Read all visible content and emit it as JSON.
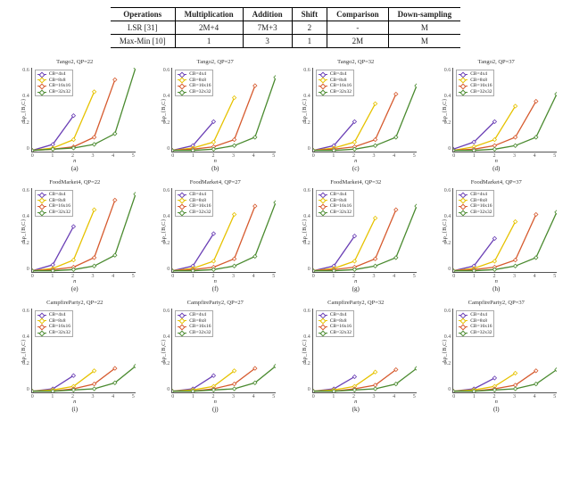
{
  "table": {
    "headers": [
      "Operations",
      "Multiplication",
      "Addition",
      "Shift",
      "Comparison",
      "Down-sampling"
    ],
    "rows": [
      {
        "name": "LSR [31]",
        "cells": [
          "2M+4",
          "7M+3",
          "2",
          "-",
          "M"
        ]
      },
      {
        "name": "Max-Min [10]",
        "cells": [
          "1",
          "3",
          "1",
          "2M",
          "M"
        ]
      }
    ]
  },
  "chart_common": {
    "ylabel": "Δρ_{B,C}",
    "xlabel": "n",
    "xticks": [
      "0",
      "1",
      "2",
      "3",
      "4",
      "5"
    ],
    "yticks": [
      "0",
      "0.2",
      "0.4",
      "0.6"
    ],
    "ylim": [
      0,
      0.7
    ],
    "xlim": [
      0,
      5
    ],
    "legend": [
      {
        "label": "CB=4x4",
        "color": "#6a3fb5"
      },
      {
        "label": "CB=8x8",
        "color": "#e6c200"
      },
      {
        "label": "CB=16x16",
        "color": "#d65a2e"
      },
      {
        "label": "CB=32x32",
        "color": "#4a8a2f"
      }
    ]
  },
  "chart_data": [
    {
      "id": "a",
      "title": "Tango2, QP=22",
      "series": [
        {
          "name": "CB=4x4",
          "color": "#6a3fb5",
          "x": [
            0,
            1,
            2
          ],
          "y": [
            0.01,
            0.06,
            0.3
          ]
        },
        {
          "name": "CB=8x8",
          "color": "#e6c200",
          "x": [
            0,
            1,
            2,
            3
          ],
          "y": [
            0.01,
            0.03,
            0.1,
            0.5
          ]
        },
        {
          "name": "CB=16x16",
          "color": "#d65a2e",
          "x": [
            0,
            1,
            2,
            3,
            4
          ],
          "y": [
            0.01,
            0.02,
            0.04,
            0.12,
            0.6
          ]
        },
        {
          "name": "CB=32x32",
          "color": "#4a8a2f",
          "x": [
            0,
            1,
            2,
            3,
            4,
            5
          ],
          "y": [
            0.01,
            0.02,
            0.03,
            0.06,
            0.15,
            0.7
          ]
        }
      ]
    },
    {
      "id": "b",
      "title": "Tango2, QP=27",
      "series": [
        {
          "name": "CB=4x4",
          "color": "#6a3fb5",
          "x": [
            0,
            1,
            2
          ],
          "y": [
            0.01,
            0.05,
            0.25
          ]
        },
        {
          "name": "CB=8x8",
          "color": "#e6c200",
          "x": [
            0,
            1,
            2,
            3
          ],
          "y": [
            0.01,
            0.03,
            0.08,
            0.45
          ]
        },
        {
          "name": "CB=16x16",
          "color": "#d65a2e",
          "x": [
            0,
            1,
            2,
            3,
            4
          ],
          "y": [
            0.01,
            0.02,
            0.04,
            0.1,
            0.55
          ]
        },
        {
          "name": "CB=32x32",
          "color": "#4a8a2f",
          "x": [
            0,
            1,
            2,
            3,
            4,
            5
          ],
          "y": [
            0.01,
            0.01,
            0.02,
            0.05,
            0.12,
            0.62
          ]
        }
      ]
    },
    {
      "id": "c",
      "title": "Tango2, QP=32",
      "series": [
        {
          "name": "CB=4x4",
          "color": "#6a3fb5",
          "x": [
            0,
            1,
            2
          ],
          "y": [
            0.01,
            0.05,
            0.25
          ]
        },
        {
          "name": "CB=8x8",
          "color": "#e6c200",
          "x": [
            0,
            1,
            2,
            3
          ],
          "y": [
            0.01,
            0.03,
            0.08,
            0.4
          ]
        },
        {
          "name": "CB=16x16",
          "color": "#d65a2e",
          "x": [
            0,
            1,
            2,
            3,
            4
          ],
          "y": [
            0.01,
            0.02,
            0.04,
            0.1,
            0.48
          ]
        },
        {
          "name": "CB=32x32",
          "color": "#4a8a2f",
          "x": [
            0,
            1,
            2,
            3,
            4,
            5
          ],
          "y": [
            0.01,
            0.01,
            0.02,
            0.05,
            0.12,
            0.55
          ]
        }
      ]
    },
    {
      "id": "d",
      "title": "Tango2, QP=37",
      "series": [
        {
          "name": "CB=4x4",
          "color": "#6a3fb5",
          "x": [
            0,
            1,
            2
          ],
          "y": [
            0.02,
            0.08,
            0.25
          ]
        },
        {
          "name": "CB=8x8",
          "color": "#e6c200",
          "x": [
            0,
            1,
            2,
            3
          ],
          "y": [
            0.01,
            0.04,
            0.1,
            0.38
          ]
        },
        {
          "name": "CB=16x16",
          "color": "#d65a2e",
          "x": [
            0,
            1,
            2,
            3,
            4
          ],
          "y": [
            0.01,
            0.02,
            0.05,
            0.12,
            0.42
          ]
        },
        {
          "name": "CB=32x32",
          "color": "#4a8a2f",
          "x": [
            0,
            1,
            2,
            3,
            4,
            5
          ],
          "y": [
            0.01,
            0.01,
            0.02,
            0.05,
            0.12,
            0.48
          ]
        }
      ]
    },
    {
      "id": "e",
      "title": "FoodMarket4, QP=22",
      "series": [
        {
          "name": "CB=4x4",
          "color": "#6a3fb5",
          "x": [
            0,
            1,
            2
          ],
          "y": [
            0.01,
            0.06,
            0.38
          ]
        },
        {
          "name": "CB=8x8",
          "color": "#e6c200",
          "x": [
            0,
            1,
            2,
            3
          ],
          "y": [
            0.01,
            0.03,
            0.1,
            0.52
          ]
        },
        {
          "name": "CB=16x16",
          "color": "#d65a2e",
          "x": [
            0,
            1,
            2,
            3,
            4
          ],
          "y": [
            0.01,
            0.02,
            0.04,
            0.12,
            0.6
          ]
        },
        {
          "name": "CB=32x32",
          "color": "#4a8a2f",
          "x": [
            0,
            1,
            2,
            3,
            4,
            5
          ],
          "y": [
            0.01,
            0.01,
            0.02,
            0.05,
            0.14,
            0.65
          ]
        }
      ]
    },
    {
      "id": "f",
      "title": "FoodMarket4, QP=27",
      "series": [
        {
          "name": "CB=4x4",
          "color": "#6a3fb5",
          "x": [
            0,
            1,
            2
          ],
          "y": [
            0.01,
            0.05,
            0.32
          ]
        },
        {
          "name": "CB=8x8",
          "color": "#e6c200",
          "x": [
            0,
            1,
            2,
            3
          ],
          "y": [
            0.01,
            0.03,
            0.09,
            0.48
          ]
        },
        {
          "name": "CB=16x16",
          "color": "#d65a2e",
          "x": [
            0,
            1,
            2,
            3,
            4
          ],
          "y": [
            0.01,
            0.02,
            0.04,
            0.11,
            0.55
          ]
        },
        {
          "name": "CB=32x32",
          "color": "#4a8a2f",
          "x": [
            0,
            1,
            2,
            3,
            4,
            5
          ],
          "y": [
            0.01,
            0.01,
            0.02,
            0.05,
            0.13,
            0.58
          ]
        }
      ]
    },
    {
      "id": "g",
      "title": "FoodMarket4, QP=32",
      "series": [
        {
          "name": "CB=4x4",
          "color": "#6a3fb5",
          "x": [
            0,
            1,
            2
          ],
          "y": [
            0.01,
            0.05,
            0.3
          ]
        },
        {
          "name": "CB=8x8",
          "color": "#e6c200",
          "x": [
            0,
            1,
            2,
            3
          ],
          "y": [
            0.01,
            0.03,
            0.09,
            0.45
          ]
        },
        {
          "name": "CB=16x16",
          "color": "#d65a2e",
          "x": [
            0,
            1,
            2,
            3,
            4
          ],
          "y": [
            0.01,
            0.02,
            0.04,
            0.11,
            0.52
          ]
        },
        {
          "name": "CB=32x32",
          "color": "#4a8a2f",
          "x": [
            0,
            1,
            2,
            3,
            4,
            5
          ],
          "y": [
            0.01,
            0.01,
            0.02,
            0.05,
            0.12,
            0.55
          ]
        }
      ]
    },
    {
      "id": "h",
      "title": "FoodMarket4, QP=37",
      "series": [
        {
          "name": "CB=4x4",
          "color": "#6a3fb5",
          "x": [
            0,
            1,
            2
          ],
          "y": [
            0.01,
            0.05,
            0.28
          ]
        },
        {
          "name": "CB=8x8",
          "color": "#e6c200",
          "x": [
            0,
            1,
            2,
            3
          ],
          "y": [
            0.01,
            0.03,
            0.09,
            0.42
          ]
        },
        {
          "name": "CB=16x16",
          "color": "#d65a2e",
          "x": [
            0,
            1,
            2,
            3,
            4
          ],
          "y": [
            0.01,
            0.02,
            0.04,
            0.1,
            0.48
          ]
        },
        {
          "name": "CB=32x32",
          "color": "#4a8a2f",
          "x": [
            0,
            1,
            2,
            3,
            4,
            5
          ],
          "y": [
            0.01,
            0.01,
            0.02,
            0.05,
            0.12,
            0.5
          ]
        }
      ]
    },
    {
      "id": "i",
      "title": "CampfireParty2, QP=22",
      "series": [
        {
          "name": "CB=4x4",
          "color": "#6a3fb5",
          "x": [
            0,
            1,
            2
          ],
          "y": [
            0.01,
            0.03,
            0.14
          ]
        },
        {
          "name": "CB=8x8",
          "color": "#e6c200",
          "x": [
            0,
            1,
            2,
            3
          ],
          "y": [
            0.01,
            0.02,
            0.05,
            0.18
          ]
        },
        {
          "name": "CB=16x16",
          "color": "#d65a2e",
          "x": [
            0,
            1,
            2,
            3,
            4
          ],
          "y": [
            0.01,
            0.01,
            0.03,
            0.07,
            0.2
          ]
        },
        {
          "name": "CB=32x32",
          "color": "#4a8a2f",
          "x": [
            0,
            1,
            2,
            3,
            4,
            5
          ],
          "y": [
            0.01,
            0.01,
            0.02,
            0.03,
            0.08,
            0.22
          ]
        }
      ]
    },
    {
      "id": "j",
      "title": "CampfireParty2, QP=27",
      "series": [
        {
          "name": "CB=4x4",
          "color": "#6a3fb5",
          "x": [
            0,
            1,
            2
          ],
          "y": [
            0.01,
            0.03,
            0.14
          ]
        },
        {
          "name": "CB=8x8",
          "color": "#e6c200",
          "x": [
            0,
            1,
            2,
            3
          ],
          "y": [
            0.01,
            0.02,
            0.05,
            0.18
          ]
        },
        {
          "name": "CB=16x16",
          "color": "#d65a2e",
          "x": [
            0,
            1,
            2,
            3,
            4
          ],
          "y": [
            0.01,
            0.01,
            0.03,
            0.07,
            0.2
          ]
        },
        {
          "name": "CB=32x32",
          "color": "#4a8a2f",
          "x": [
            0,
            1,
            2,
            3,
            4,
            5
          ],
          "y": [
            0.01,
            0.01,
            0.02,
            0.03,
            0.08,
            0.22
          ]
        }
      ]
    },
    {
      "id": "k",
      "title": "CampfireParty2, QP=32",
      "series": [
        {
          "name": "CB=4x4",
          "color": "#6a3fb5",
          "x": [
            0,
            1,
            2
          ],
          "y": [
            0.01,
            0.03,
            0.13
          ]
        },
        {
          "name": "CB=8x8",
          "color": "#e6c200",
          "x": [
            0,
            1,
            2,
            3
          ],
          "y": [
            0.01,
            0.02,
            0.05,
            0.17
          ]
        },
        {
          "name": "CB=16x16",
          "color": "#d65a2e",
          "x": [
            0,
            1,
            2,
            3,
            4
          ],
          "y": [
            0.01,
            0.01,
            0.03,
            0.06,
            0.19
          ]
        },
        {
          "name": "CB=32x32",
          "color": "#4a8a2f",
          "x": [
            0,
            1,
            2,
            3,
            4,
            5
          ],
          "y": [
            0.01,
            0.01,
            0.02,
            0.03,
            0.07,
            0.2
          ]
        }
      ]
    },
    {
      "id": "l",
      "title": "CampfireParty2, QP=37",
      "series": [
        {
          "name": "CB=4x4",
          "color": "#6a3fb5",
          "x": [
            0,
            1,
            2
          ],
          "y": [
            0.01,
            0.03,
            0.12
          ]
        },
        {
          "name": "CB=8x8",
          "color": "#e6c200",
          "x": [
            0,
            1,
            2,
            3
          ],
          "y": [
            0.01,
            0.02,
            0.05,
            0.16
          ]
        },
        {
          "name": "CB=16x16",
          "color": "#d65a2e",
          "x": [
            0,
            1,
            2,
            3,
            4
          ],
          "y": [
            0.01,
            0.01,
            0.03,
            0.06,
            0.18
          ]
        },
        {
          "name": "CB=32x32",
          "color": "#4a8a2f",
          "x": [
            0,
            1,
            2,
            3,
            4,
            5
          ],
          "y": [
            0.01,
            0.01,
            0.02,
            0.03,
            0.07,
            0.19
          ]
        }
      ]
    }
  ]
}
